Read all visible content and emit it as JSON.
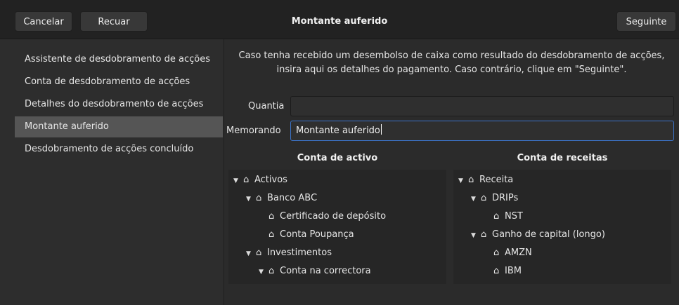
{
  "header": {
    "cancel_label": "Cancelar",
    "back_label": "Recuar",
    "title": "Montante auferido",
    "next_label": "Seguinte"
  },
  "sidebar": {
    "items": [
      {
        "label": "Assistente de desdobramento de acções"
      },
      {
        "label": "Conta de desdobramento de acções"
      },
      {
        "label": "Detalhes do desdobramento de acções"
      },
      {
        "label": "Montante auferido"
      },
      {
        "label": "Desdobramento de acções concluído"
      }
    ],
    "active_index": 3
  },
  "main": {
    "description_line1": "Caso tenha recebido um desembolso de caixa como resultado do desdobramento de acções,",
    "description_line2": "insira aqui os detalhes do pagamento. Caso contrário, clique em \"Seguinte\".",
    "amount_label": "Quantia",
    "amount_value": "",
    "memo_label": "Memorando",
    "memo_value": "Montante auferido",
    "asset_header": "Conta de activo",
    "income_header": "Conta de receitas"
  },
  "asset_tree": [
    {
      "label": "Activos",
      "expanded": true,
      "depth": 0
    },
    {
      "label": "Banco ABC",
      "expanded": true,
      "depth": 1
    },
    {
      "label": "Certificado de depósito",
      "expanded": null,
      "depth": 2
    },
    {
      "label": "Conta Poupança",
      "expanded": null,
      "depth": 2
    },
    {
      "label": "Investimentos",
      "expanded": true,
      "depth": 1
    },
    {
      "label": "Conta na correctora",
      "expanded": true,
      "depth": 2
    }
  ],
  "income_tree": [
    {
      "label": "Receita",
      "expanded": true,
      "depth": 0
    },
    {
      "label": "DRIPs",
      "expanded": true,
      "depth": 1
    },
    {
      "label": "NST",
      "expanded": null,
      "depth": 2
    },
    {
      "label": "Ganho de capital (longo)",
      "expanded": true,
      "depth": 1
    },
    {
      "label": "AMZN",
      "expanded": null,
      "depth": 2
    },
    {
      "label": "IBM",
      "expanded": null,
      "depth": 2
    }
  ],
  "icons": {
    "account": "bank-icon",
    "expander": "triangle-down-icon"
  },
  "colors": {
    "focus_border": "#3b73c8",
    "active_sidebar": "#555555"
  }
}
